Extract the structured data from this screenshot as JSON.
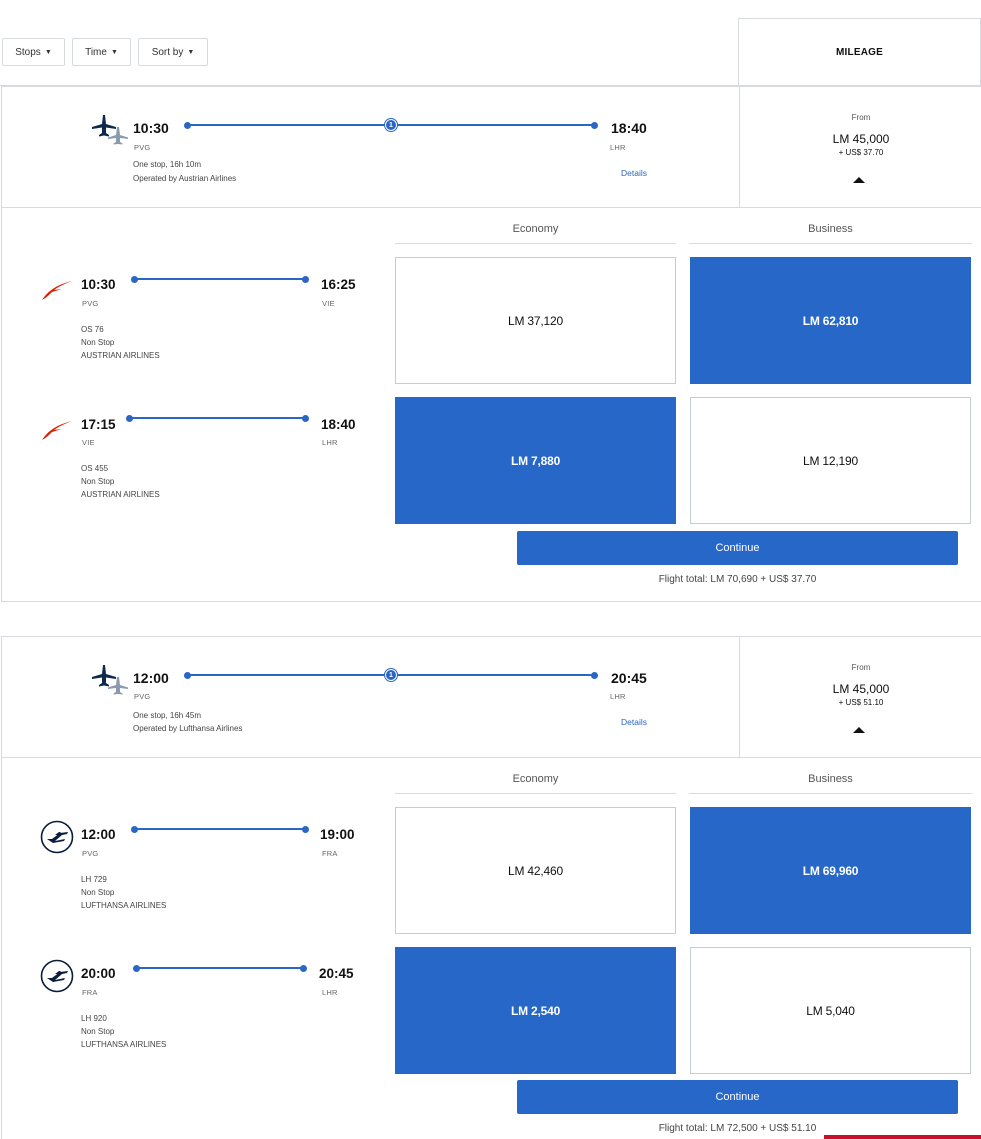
{
  "filters": {
    "stops": "Stops",
    "time": "Time",
    "sort": "Sort by",
    "mileage": "MILEAGE"
  },
  "itineraries": [
    {
      "summary": {
        "depart_time": "10:30",
        "depart_code": "PVG",
        "arrive_time": "18:40",
        "arrive_code": "LHR",
        "stops_badge": "1",
        "duration": "One stop, 16h 10m",
        "operated_by": "Operated by Austrian Airlines",
        "details": "Details",
        "price_from": "From",
        "price_miles": "LM 45,000",
        "price_cash": "+ US$ 37.70"
      },
      "cabins": [
        "Economy",
        "Business"
      ],
      "segments": [
        {
          "airline_icon": "austrian-airlines-logo",
          "depart_time": "10:30",
          "depart_code": "PVG",
          "arrive_time": "16:25",
          "arrive_code": "VIE",
          "flight_no": "OS 76",
          "stops": "Non Stop",
          "airline": "AUSTRIAN AIRLINES",
          "fares": [
            {
              "label": "LM 37,120",
              "selected": false
            },
            {
              "label": "LM 62,810",
              "selected": true
            }
          ]
        },
        {
          "airline_icon": "austrian-airlines-logo",
          "depart_time": "17:15",
          "depart_code": "VIE",
          "arrive_time": "18:40",
          "arrive_code": "LHR",
          "flight_no": "OS 455",
          "stops": "Non Stop",
          "airline": "AUSTRIAN AIRLINES",
          "fares": [
            {
              "label": "LM 7,880",
              "selected": true
            },
            {
              "label": "LM 12,190",
              "selected": false
            }
          ]
        }
      ],
      "continue": "Continue",
      "flight_total": "Flight total: LM 70,690 + US$ 37.70"
    },
    {
      "summary": {
        "depart_time": "12:00",
        "depart_code": "PVG",
        "arrive_time": "20:45",
        "arrive_code": "LHR",
        "stops_badge": "1",
        "duration": "One stop, 16h 45m",
        "operated_by": "Operated by Lufthansa Airlines",
        "details": "Details",
        "price_from": "From",
        "price_miles": "LM 45,000",
        "price_cash": "+ US$ 51.10"
      },
      "cabins": [
        "Economy",
        "Business"
      ],
      "segments": [
        {
          "airline_icon": "lufthansa-logo",
          "depart_time": "12:00",
          "depart_code": "PVG",
          "arrive_time": "19:00",
          "arrive_code": "FRA",
          "flight_no": "LH 729",
          "stops": "Non Stop",
          "airline": "LUFTHANSA AIRLINES",
          "fares": [
            {
              "label": "LM 42,460",
              "selected": false
            },
            {
              "label": "LM 69,960",
              "selected": true
            }
          ]
        },
        {
          "airline_icon": "lufthansa-logo",
          "depart_time": "20:00",
          "depart_code": "FRA",
          "arrive_time": "20:45",
          "arrive_code": "LHR",
          "flight_no": "LH 920",
          "stops": "Non Stop",
          "airline": "LUFTHANSA AIRLINES",
          "fares": [
            {
              "label": "LM 2,540",
              "selected": true
            },
            {
              "label": "LM 5,040",
              "selected": false
            }
          ]
        }
      ],
      "continue": "Continue",
      "flight_total": "Flight total: LM 72,500 + US$ 51.10"
    }
  ],
  "colors": {
    "accent": "#2667c7",
    "austrian_red": "#d81e05",
    "lufthansa_navy": "#0a1d3d",
    "page_strip": "#c8102e"
  }
}
